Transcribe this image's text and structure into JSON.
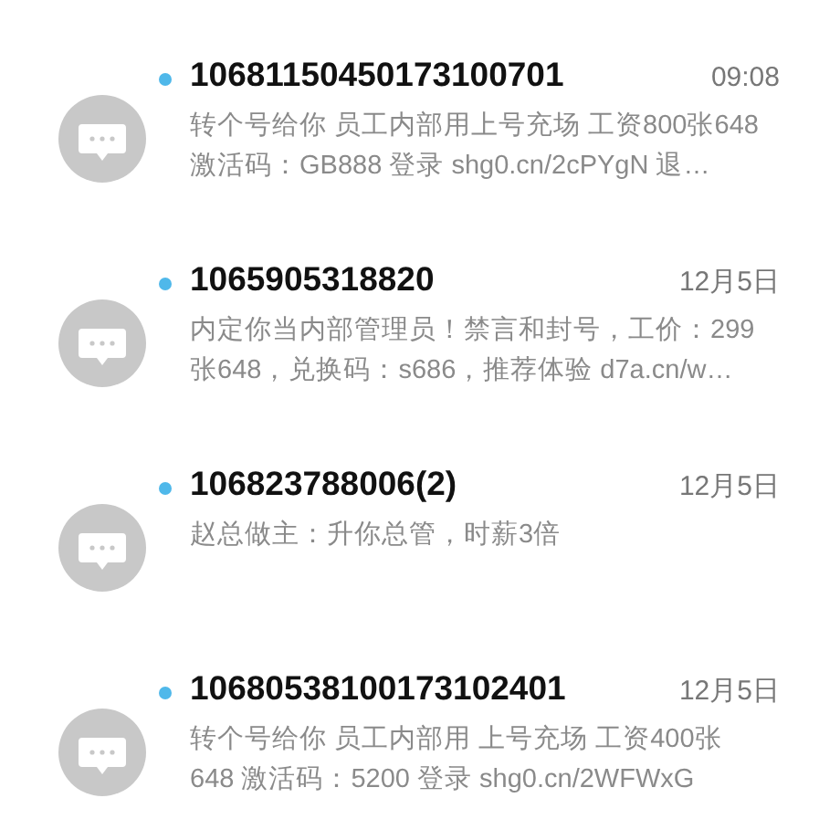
{
  "messages": [
    {
      "sender": "10681150450173100701",
      "time": "09:08",
      "unread": true,
      "preview_lines": [
        "转个号给你 员工内部用上号充场 工资800张648",
        "激活码：GB888 登录 shg0.cn/2cPYgN  退…"
      ]
    },
    {
      "sender": "1065905318820",
      "time": "12月5日",
      "unread": true,
      "preview_lines": [
        "内定你当内部管理员！禁言和封号，工价：299",
        "张648，兑换码：s686，推荐体验 d7a.cn/w…"
      ]
    },
    {
      "sender": "106823788006(2)",
      "time": "12月5日",
      "unread": true,
      "preview_lines": [
        "赵总做主：升你总管，时薪3倍"
      ]
    },
    {
      "sender": "10680538100173102401",
      "time": "12月5日",
      "unread": true,
      "preview_lines": [
        "转个号给你 员工内部用 上号充场 工资400张",
        "648 激活码：5200 登录 shg0.cn/2WFWxG"
      ]
    }
  ]
}
